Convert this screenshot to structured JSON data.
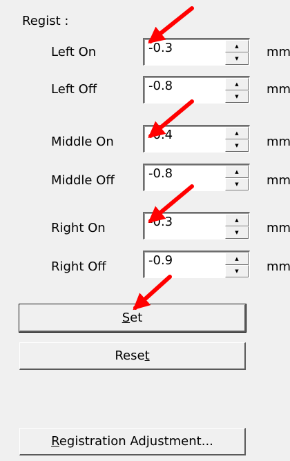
{
  "regist": {
    "label": "Regist :",
    "unit": "mm",
    "rows": [
      {
        "label": "Left On",
        "value": "-0.3"
      },
      {
        "label": "Left Off",
        "value": "-0.8"
      },
      {
        "label": "Middle On",
        "value": "-0.4"
      },
      {
        "label": "Middle Off",
        "value": "-0.8"
      },
      {
        "label": "Right On",
        "value": "-0.3"
      },
      {
        "label": "Right Off",
        "value": "-0.9"
      }
    ]
  },
  "buttons": {
    "set": {
      "pre": "",
      "u": "S",
      "post": "et"
    },
    "reset": {
      "pre": "Rese",
      "u": "t",
      "post": ""
    },
    "registration": {
      "pre": "",
      "u": "R",
      "post": "egistration Adjustment..."
    }
  },
  "icons": {
    "spin_up": "triangle-up",
    "spin_down": "triangle-down",
    "annotation": "red-arrow"
  },
  "colors": {
    "annotation_arrow": "#ff0000"
  }
}
